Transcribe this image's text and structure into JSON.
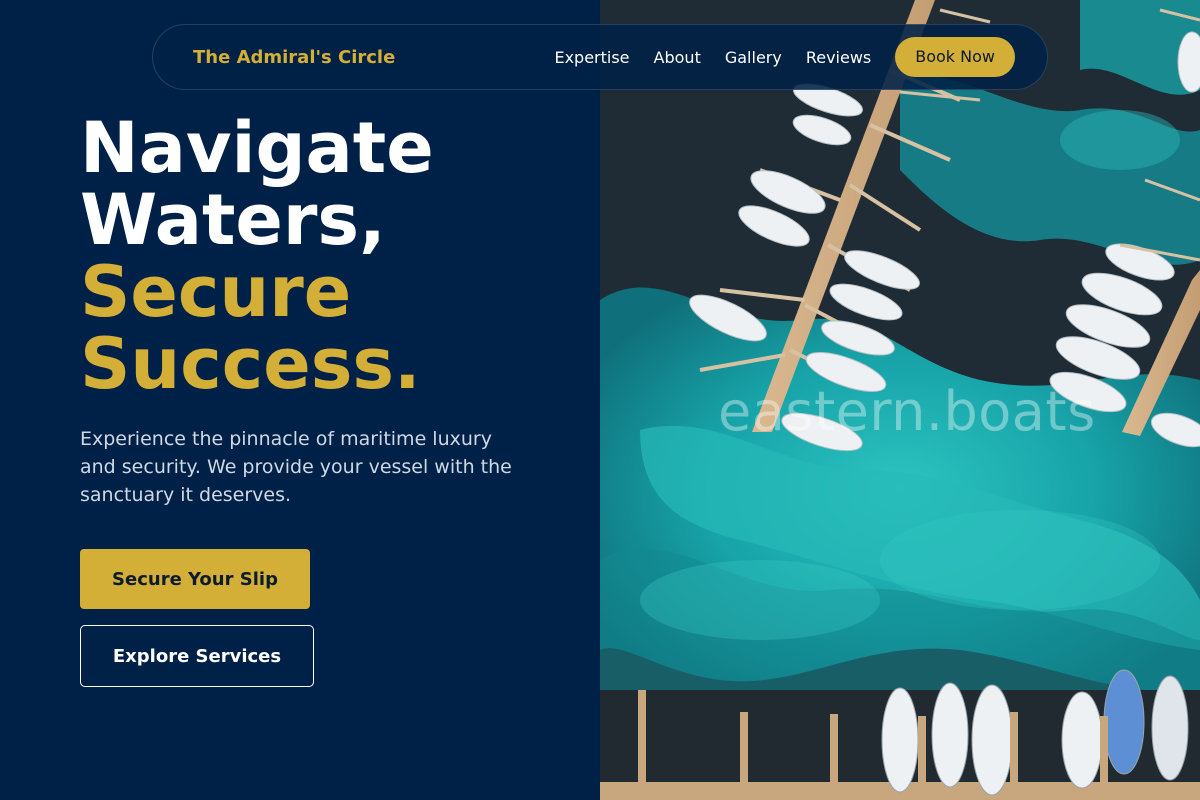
{
  "nav": {
    "brand": "The Admiral's Circle",
    "links": [
      "Expertise",
      "About",
      "Gallery",
      "Reviews"
    ],
    "cta": "Book Now"
  },
  "hero": {
    "title_line1": "Navigate",
    "title_line2": "Waters,",
    "title_line3": "Secure",
    "title_line4": "Success.",
    "description": "Experience the pinnacle of maritime luxury and security. We provide your vessel with the sanctuary it deserves.",
    "primary_button": "Secure Your Slip",
    "secondary_button": "Explore Services"
  },
  "image": {
    "subject": "aerial view of marina with docked boats over turquoise water",
    "watermark": "eastern.boats"
  },
  "colors": {
    "navy": "#002147",
    "gold": "#D4AF37",
    "white": "#ffffff",
    "muted_text": "#cfd8e3",
    "water_deep": "#1e2a33",
    "water_turquoise": "#1aa6a6"
  }
}
